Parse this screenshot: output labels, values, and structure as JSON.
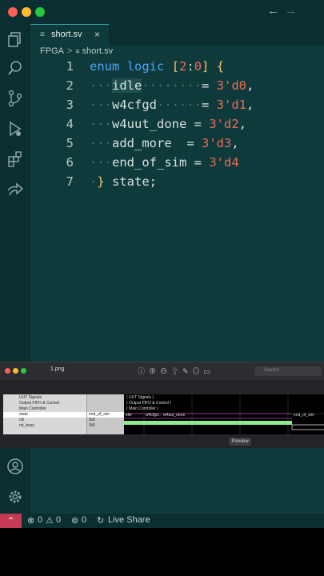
{
  "editor": {
    "tab": {
      "label": "short.sv",
      "close": "×",
      "file_glyph": "≡"
    },
    "breadcrumb": {
      "folder": "FPGA",
      "separator": ">",
      "file": "short.sv"
    },
    "code_lines": [
      {
        "number": "1",
        "tokens": [
          {
            "t": "enum",
            "c": "kw"
          },
          {
            "t": " ",
            "c": "plain"
          },
          {
            "t": "logic",
            "c": "kw"
          },
          {
            "t": " ",
            "c": "plain"
          },
          {
            "t": "[",
            "c": "br"
          },
          {
            "t": "2",
            "c": "num"
          },
          {
            "t": ":",
            "c": "plain"
          },
          {
            "t": "0",
            "c": "num"
          },
          {
            "t": "]",
            "c": "br"
          },
          {
            "t": " ",
            "c": "plain"
          },
          {
            "t": "{",
            "c": "br"
          }
        ]
      },
      {
        "number": "2",
        "tokens": [
          {
            "t": "···",
            "c": "ws"
          },
          {
            "t": "idle",
            "c": "id hl"
          },
          {
            "t": "········",
            "c": "ws"
          },
          {
            "t": "= ",
            "c": "plain"
          },
          {
            "t": "3'd0",
            "c": "num"
          },
          {
            "t": ",",
            "c": "plain"
          }
        ]
      },
      {
        "number": "3",
        "tokens": [
          {
            "t": "···",
            "c": "ws"
          },
          {
            "t": "w4cfgd",
            "c": "id"
          },
          {
            "t": "······",
            "c": "ws"
          },
          {
            "t": "= ",
            "c": "plain"
          },
          {
            "t": "3'd1",
            "c": "num"
          },
          {
            "t": ",",
            "c": "plain"
          }
        ]
      },
      {
        "number": "4",
        "tokens": [
          {
            "t": "···",
            "c": "ws"
          },
          {
            "t": "w4uut_done",
            "c": "id"
          },
          {
            "t": " = ",
            "c": "plain"
          },
          {
            "t": "3'd2",
            "c": "num"
          },
          {
            "t": ",",
            "c": "plain"
          }
        ]
      },
      {
        "number": "5",
        "tokens": [
          {
            "t": "···",
            "c": "ws"
          },
          {
            "t": "add_more",
            "c": "id"
          },
          {
            "t": "  = ",
            "c": "plain"
          },
          {
            "t": "3'd3",
            "c": "num"
          },
          {
            "t": ",",
            "c": "plain"
          }
        ]
      },
      {
        "number": "6",
        "tokens": [
          {
            "t": "···",
            "c": "ws"
          },
          {
            "t": "end_of_sim",
            "c": "id"
          },
          {
            "t": " = ",
            "c": "plain"
          },
          {
            "t": "3'd4",
            "c": "num"
          }
        ]
      },
      {
        "number": "7",
        "tokens": [
          {
            "t": "·",
            "c": "ws"
          },
          {
            "t": "}",
            "c": "br"
          },
          {
            "t": " state;",
            "c": "plain"
          }
        ]
      }
    ]
  },
  "viewer": {
    "title": "1.png",
    "search_placeholder": "Search",
    "preview_label": "Preview",
    "signals": [
      {
        "name": "UUT Signals",
        "value": ""
      },
      {
        "name": "Output FIFO & Control",
        "value": ""
      },
      {
        "name": "Main Controller",
        "value": ""
      },
      {
        "name": "state",
        "value": "end_of_sim"
      },
      {
        "name": "clk",
        "value": "St0"
      },
      {
        "name": "rst_busy",
        "value": "St0"
      }
    ],
    "wave_labels": [
      "( UUT Signals )",
      "( Output FIFO & Control )",
      "( Main Controller )"
    ],
    "state_labels": [
      "idle",
      "w4cfgd...",
      "w4uut_done",
      "end_of_sim"
    ]
  },
  "statusbar": {
    "remote_icon": "⌃",
    "errors": "0",
    "warnings": "0",
    "ports": "0",
    "live_share": "Live Share"
  },
  "colors": {
    "editor_bg": "#0f3a3b",
    "chrome_bg": "#0b2f30",
    "keyword": "#4ea3f5",
    "number": "#e96a57",
    "bracket": "#f1c46b",
    "remote_badge": "#c43a55"
  }
}
